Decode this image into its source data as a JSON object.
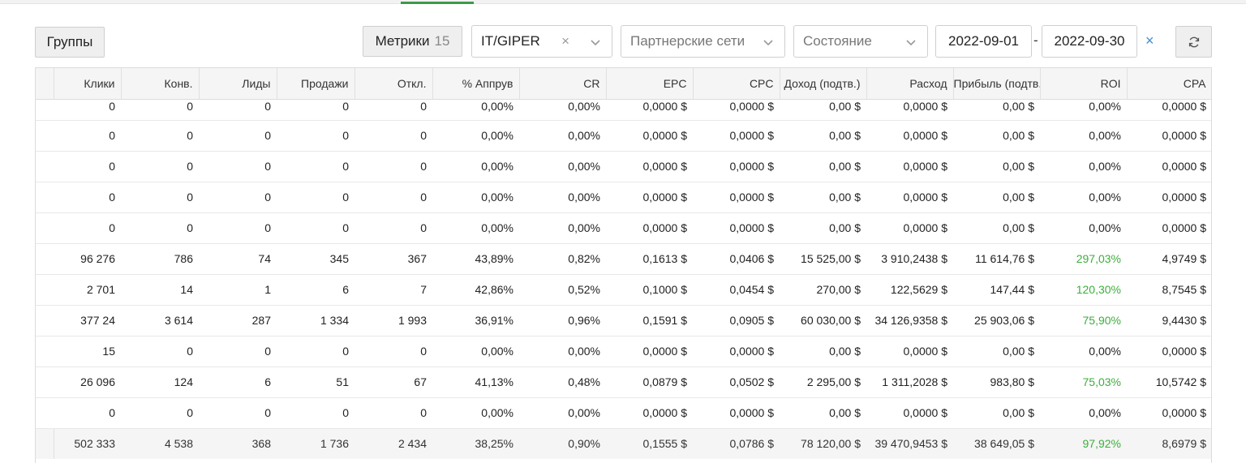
{
  "toolbar": {
    "groups_label": "Группы",
    "metrics_label": "Метрики",
    "metrics_count": "15",
    "filter_offer": "IT/GIPER",
    "filter_networks_placeholder": "Партнерские сети",
    "filter_state_placeholder": "Состояние",
    "date_from": "2022-09-01",
    "date_separator": "-",
    "date_to": "2022-09-30",
    "clear_symbol": "×",
    "refresh_icon": "refresh-icon"
  },
  "table": {
    "columns": [
      "Клики",
      "Конв.",
      "Лиды",
      "Продажи",
      "Откл.",
      "% Аппрув",
      "CR",
      "EPC",
      "CPC",
      "Доход (подтв.)",
      "Расход",
      "Прибыль (подтв.)",
      "ROI",
      "CPA"
    ],
    "rows": [
      [
        "0",
        "0",
        "0",
        "0",
        "0",
        "0,00%",
        "0,00%",
        "0,0000 $",
        "0,0000 $",
        "0,00 $",
        "0,0000 $",
        "0,00 $",
        "0,00%",
        "0,0000 $"
      ],
      [
        "0",
        "0",
        "0",
        "0",
        "0",
        "0,00%",
        "0,00%",
        "0,0000 $",
        "0,0000 $",
        "0,00 $",
        "0,0000 $",
        "0,00 $",
        "0,00%",
        "0,0000 $"
      ],
      [
        "0",
        "0",
        "0",
        "0",
        "0",
        "0,00%",
        "0,00%",
        "0,0000 $",
        "0,0000 $",
        "0,00 $",
        "0,0000 $",
        "0,00 $",
        "0,00%",
        "0,0000 $"
      ],
      [
        "0",
        "0",
        "0",
        "0",
        "0",
        "0,00%",
        "0,00%",
        "0,0000 $",
        "0,0000 $",
        "0,00 $",
        "0,0000 $",
        "0,00 $",
        "0,00%",
        "0,0000 $"
      ],
      [
        "0",
        "0",
        "0",
        "0",
        "0",
        "0,00%",
        "0,00%",
        "0,0000 $",
        "0,0000 $",
        "0,00 $",
        "0,0000 $",
        "0,00 $",
        "0,00%",
        "0,0000 $"
      ],
      [
        "96 276",
        "786",
        "74",
        "345",
        "367",
        "43,89%",
        "0,82%",
        "0,1613 $",
        "0,0406 $",
        "15 525,00 $",
        "3 910,2438 $",
        "11 614,76 $",
        "297,03%",
        "4,9749 $"
      ],
      [
        "2 701",
        "14",
        "1",
        "6",
        "7",
        "42,86%",
        "0,52%",
        "0,1000 $",
        "0,0454 $",
        "270,00 $",
        "122,5629 $",
        "147,44 $",
        "120,30%",
        "8,7545 $"
      ],
      [
        "377 24",
        "3 614",
        "287",
        "1 334",
        "1 993",
        "36,91%",
        "0,96%",
        "0,1591 $",
        "0,0905 $",
        "60 030,00 $",
        "34 126,9358 $",
        "25 903,06 $",
        "75,90%",
        "9,4430 $"
      ],
      [
        "15",
        "0",
        "0",
        "0",
        "0",
        "0,00%",
        "0,00%",
        "0,0000 $",
        "0,0000 $",
        "0,00 $",
        "0,0000 $",
        "0,00 $",
        "0,00%",
        "0,0000 $"
      ],
      [
        "26 096",
        "124",
        "6",
        "51",
        "67",
        "41,13%",
        "0,48%",
        "0,0879 $",
        "0,0502 $",
        "2 295,00 $",
        "1 311,2028 $",
        "983,80 $",
        "75,03%",
        "10,5742 $"
      ],
      [
        "0",
        "0",
        "0",
        "0",
        "0",
        "0,00%",
        "0,00%",
        "0,0000 $",
        "0,0000 $",
        "0,00 $",
        "0,0000 $",
        "0,00 $",
        "0,00%",
        "0,0000 $"
      ]
    ],
    "roi_positive_rows": [
      5,
      6,
      7,
      9
    ],
    "totals": [
      "502 333",
      "4 538",
      "368",
      "1 736",
      "2 434",
      "38,25%",
      "0,90%",
      "0,1555 $",
      "0,0786 $",
      "78 120,00 $",
      "39 470,9453 $",
      "38 649,05 $",
      "97,92%",
      "8,6979 $"
    ]
  },
  "colors": {
    "accent_green": "#3cae3c",
    "doc_icon_blue": "#3a8ed8",
    "clear_blue": "#3a8ed8"
  }
}
